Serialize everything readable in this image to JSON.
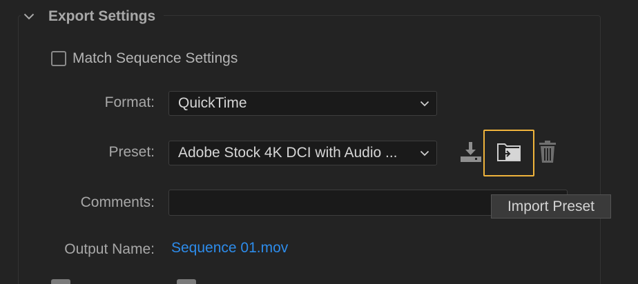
{
  "section": {
    "title": "Export Settings",
    "collapse_icon": "chevron-down-icon"
  },
  "match_sequence": {
    "label": "Match Sequence Settings",
    "checked": false
  },
  "format": {
    "label": "Format:",
    "value": "QuickTime"
  },
  "preset": {
    "label": "Preset:",
    "value": "Adobe Stock 4K DCI with Audio ...",
    "buttons": [
      {
        "name": "save-preset",
        "icon": "download-icon"
      },
      {
        "name": "import-preset",
        "icon": "folder-import-icon"
      },
      {
        "name": "delete-preset",
        "icon": "trash-icon"
      }
    ]
  },
  "comments": {
    "label": "Comments:",
    "value": ""
  },
  "output": {
    "label": "Output Name:",
    "value": "Sequence 01.mov"
  },
  "tooltip": {
    "text": "Import Preset"
  },
  "colors": {
    "background": "#232323",
    "link": "#2d8ceb",
    "highlight": "#f0b43c",
    "icon": "#8f8f8f"
  }
}
